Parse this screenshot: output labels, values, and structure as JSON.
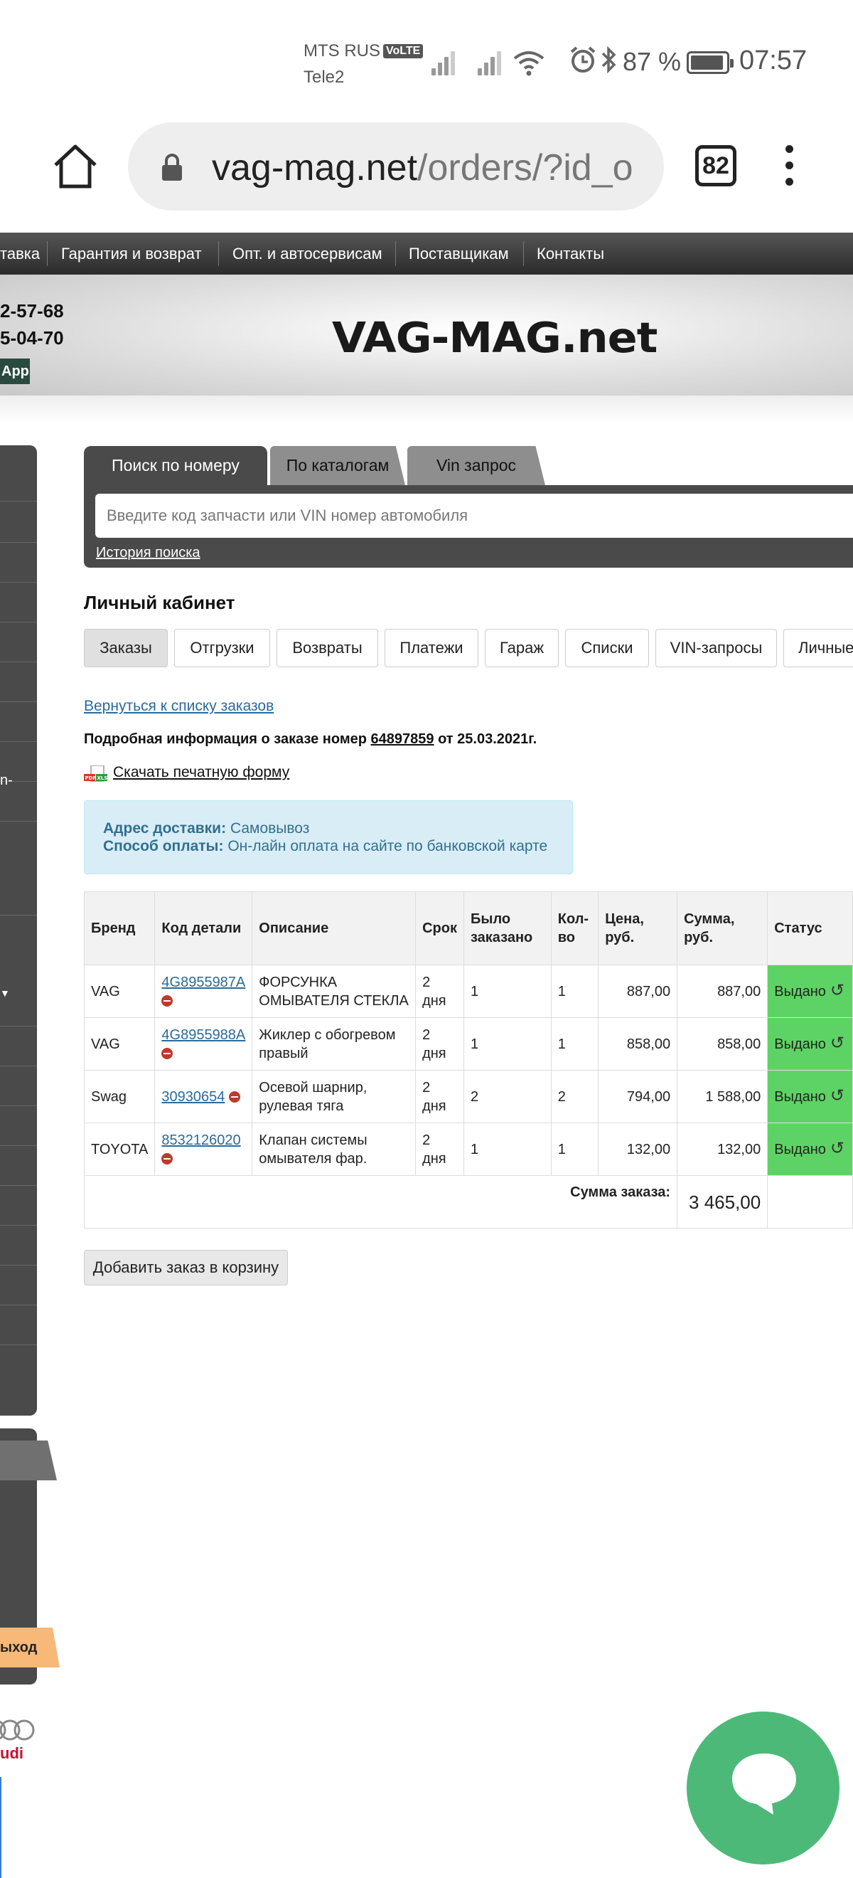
{
  "status_bar": {
    "carrier1": "MTS RUS",
    "volte": "VoLTE",
    "carrier2": "Tele2",
    "battery": "87 %",
    "time": "07:57"
  },
  "browser": {
    "url_domain": "vag-mag.net",
    "url_path": "/orders/?id_o",
    "tab_count": "82"
  },
  "site_nav": [
    "тавка",
    "Гарантия и возврат",
    "Опт. и автосервисам",
    "Поставщикам",
    "Контакты"
  ],
  "header": {
    "phone1": "2-57-68",
    "phone2": "5-04-70",
    "app": "App",
    "logo": "VAG-MAG.net"
  },
  "sidebar": {
    "fragment1": "n-",
    "exit": "ыход",
    "brand": "udi"
  },
  "search": {
    "tabs": [
      "Поиск по номеру",
      "По каталогам",
      "Vin запрос"
    ],
    "placeholder": "Введите код запчасти или VIN номер автомобиля",
    "history": "История поиска"
  },
  "cabinet": {
    "title": "Личный кабинет",
    "tabs": [
      "Заказы",
      "Отгрузки",
      "Возвраты",
      "Платежи",
      "Гараж",
      "Списки",
      "VIN-запросы",
      "Личные"
    ]
  },
  "order": {
    "back": "Вернуться к списку заказов",
    "info_prefix": "Подробная информация о заказе номер",
    "number": "64897859",
    "info_suffix": "от 25.03.2021г.",
    "print": "Скачать печатную форму",
    "delivery_label": "Адрес доставки:",
    "delivery_value": "Самовывоз",
    "payment_label": "Способ оплаты:",
    "payment_value": "Он-лайн оплата на сайте по банковской карте"
  },
  "table": {
    "headers": [
      "Бренд",
      "Код детали",
      "Описание",
      "Срок",
      "Было заказано",
      "Кол-во",
      "Цена, руб.",
      "Сумма, руб.",
      "Статус"
    ],
    "rows": [
      {
        "brand": "VAG",
        "code": "4G8955987A",
        "desc": "ФОРСУНКА ОМЫВАТЕЛЯ СТЕКЛА",
        "term": "2 дня",
        "ordered": "1",
        "qty": "1",
        "price": "887,00",
        "sum": "887,00",
        "status": "Выдано"
      },
      {
        "brand": "VAG",
        "code": "4G8955988A",
        "desc": "Жиклер с обогревом правый",
        "term": "2 дня",
        "ordered": "1",
        "qty": "1",
        "price": "858,00",
        "sum": "858,00",
        "status": "Выдано"
      },
      {
        "brand": "Swag",
        "code": "30930654",
        "desc": "Осевой шарнир, рулевая тяга",
        "term": "2 дня",
        "ordered": "2",
        "qty": "2",
        "price": "794,00",
        "sum": "1 588,00",
        "status": "Выдано"
      },
      {
        "brand": "TOYOTA",
        "code": "8532126020",
        "desc": "Клапан системы омывателя фар.",
        "term": "2 дня",
        "ordered": "1",
        "qty": "1",
        "price": "132,00",
        "sum": "132,00",
        "status": "Выдано"
      }
    ],
    "total_label": "Сумма заказа:",
    "total_value": "3 465,00"
  },
  "add_to_cart": "Добавить заказ в корзину",
  "colors": {
    "status_green": "#5ed365",
    "chat_green": "#4cb978",
    "link_blue": "#2a6a9a",
    "info_bg": "#d9edf7"
  }
}
